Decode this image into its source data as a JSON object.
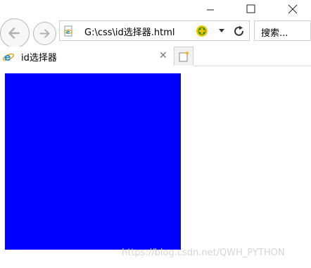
{
  "address": {
    "url": "G:\\css\\id选择器.html",
    "page_icon": "ie-page-icon",
    "compat_icon": "compatibility-view-icon",
    "dropdown_icon": "chevron-down-icon",
    "refresh_icon": "refresh-icon"
  },
  "search": {
    "placeholder": "搜索..."
  },
  "tab": {
    "title": "id选择器",
    "icon": "ie-logo-icon",
    "close_glyph": "✕"
  },
  "newtab": {
    "icon": "new-tab-icon"
  },
  "page": {
    "box_color": "#0000ff"
  },
  "watermark": "https://blog.csdn.net/QWH_PYTHON",
  "colors": {
    "box": "#0000ff",
    "ie_blue": "#1e8fd6",
    "compat_yellow": "#f2c600",
    "compat_green": "#2e8b2e"
  }
}
